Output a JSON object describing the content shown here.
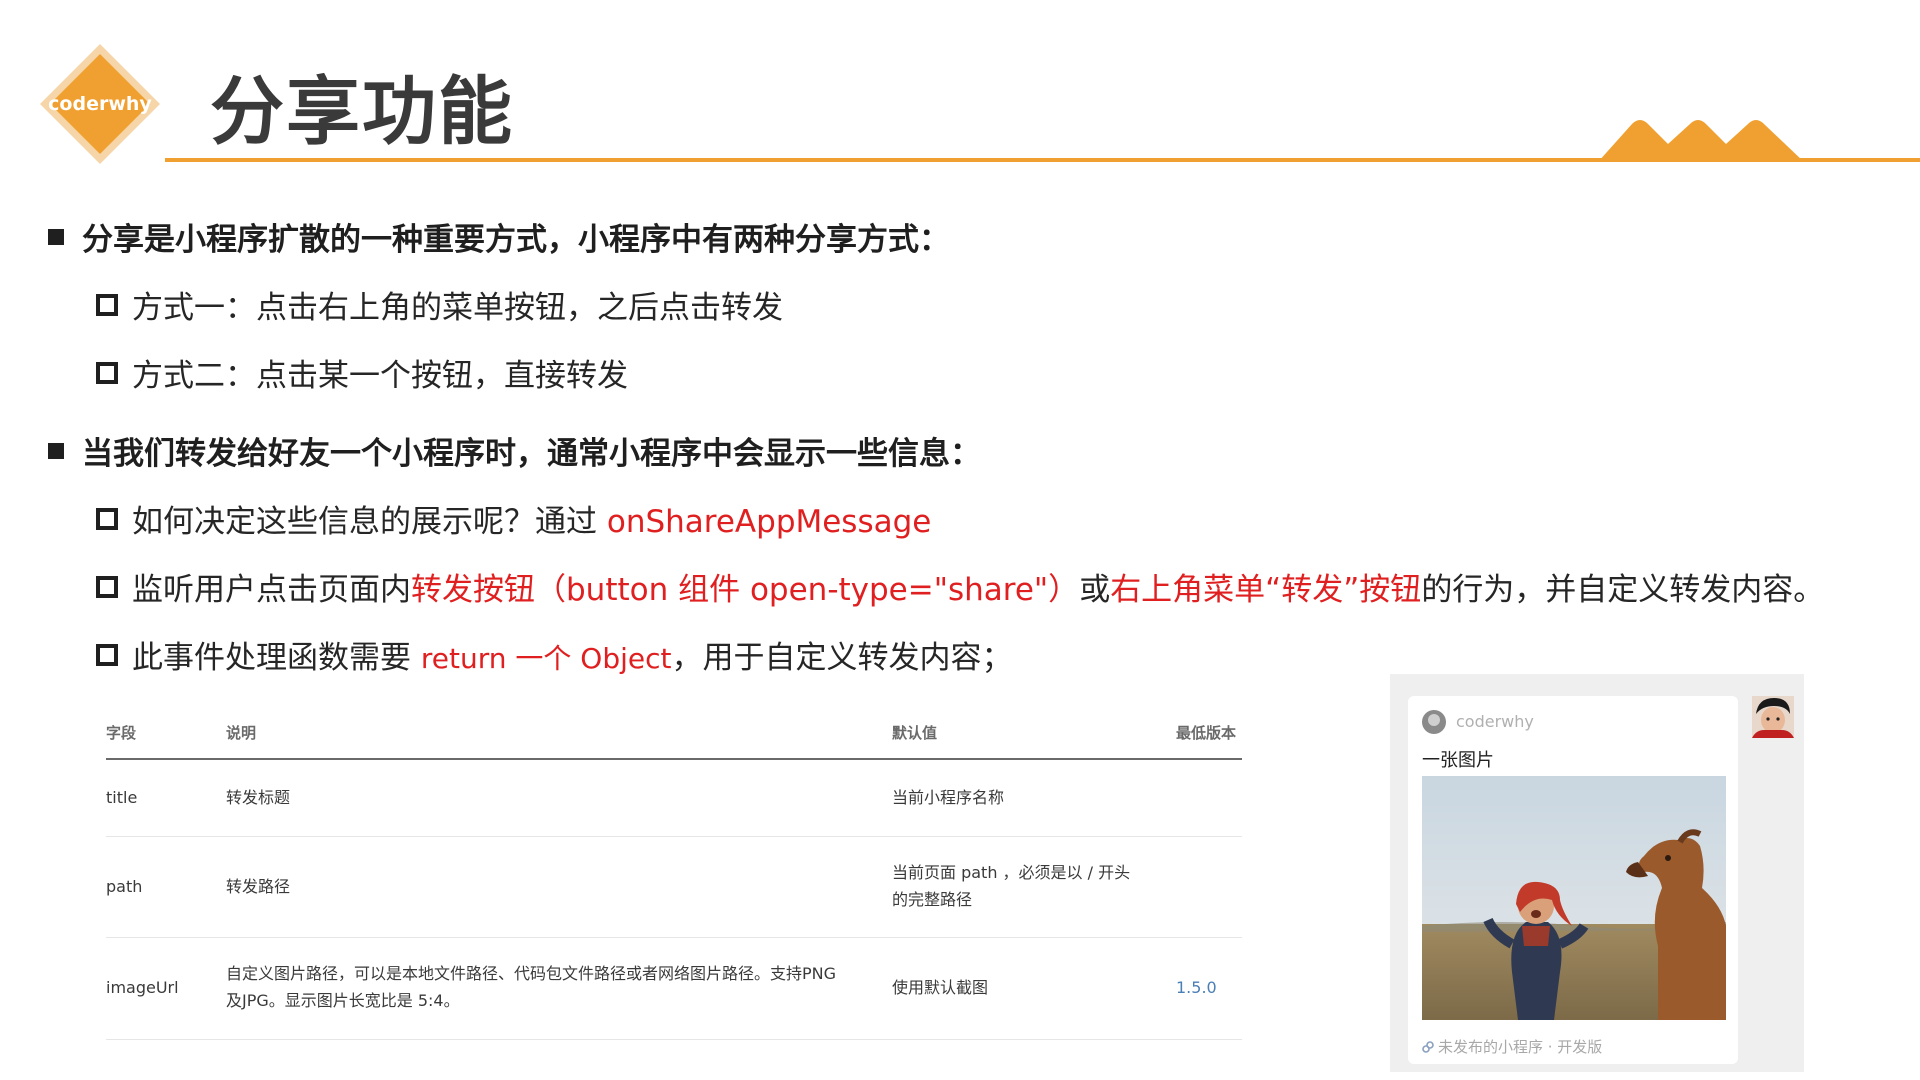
{
  "header": {
    "logo_text": "coderwhy",
    "title": "分享功能"
  },
  "bullets": [
    {
      "level": 1,
      "parts": [
        {
          "text": "分享是小程序扩散的一种重要方式，小程序中有两种分享方式："
        }
      ]
    },
    {
      "level": 2,
      "parts": [
        {
          "text": "方式一：点击右上角的菜单按钮，之后点击转发"
        }
      ]
    },
    {
      "level": 2,
      "parts": [
        {
          "text": "方式二：点击某一个按钮，直接转发"
        }
      ]
    },
    {
      "level": 1,
      "parts": [
        {
          "text": "当我们转发给好友一个小程序时，通常小程序中会显示一些信息："
        }
      ]
    },
    {
      "level": 2,
      "parts": [
        {
          "text": "如何决定这些信息的展示呢？通过 "
        },
        {
          "text": "onShareAppMessage",
          "red": true
        }
      ]
    },
    {
      "level": 2,
      "parts": [
        {
          "text": "监听用户点击页面内"
        },
        {
          "text": "转发按钮（button 组件 open-type=\"share\"）",
          "red": true
        },
        {
          "text": "或"
        },
        {
          "text": "右上角菜单“转发”按钮",
          "red": true
        },
        {
          "text": "的行为，并自定义转发内容。"
        }
      ]
    },
    {
      "level": 2,
      "parts": [
        {
          "text": "此事件处理函数需要 "
        },
        {
          "text": "return 一个 Object",
          "red": true,
          "small": true
        },
        {
          "text": "，用于自定义转发内容；"
        }
      ]
    }
  ],
  "table": {
    "headers": [
      "字段",
      "说明",
      "默认值",
      "最低版本"
    ],
    "rows": [
      {
        "field": "title",
        "desc": "转发标题",
        "default": "当前小程序名称",
        "version": ""
      },
      {
        "field": "path",
        "desc": "转发路径",
        "default": "当前页面 path ，必须是以 / 开头的完整路径",
        "version": ""
      },
      {
        "field": "imageUrl",
        "desc": "自定义图片路径，可以是本地文件路径、代码包文件路径或者网络图片路径。支持PNG 及JPG。显示图片长宽比是 5:4。",
        "default": "使用默认截图",
        "version": "1.5.0"
      }
    ]
  },
  "share_card": {
    "app_name": "coderwhy",
    "title": "一张图片",
    "footer": "未发布的小程序 · 开发版"
  },
  "colors": {
    "accent": "#f0a030",
    "highlight_red": "#e02020",
    "version_blue": "#4a7fb5"
  }
}
